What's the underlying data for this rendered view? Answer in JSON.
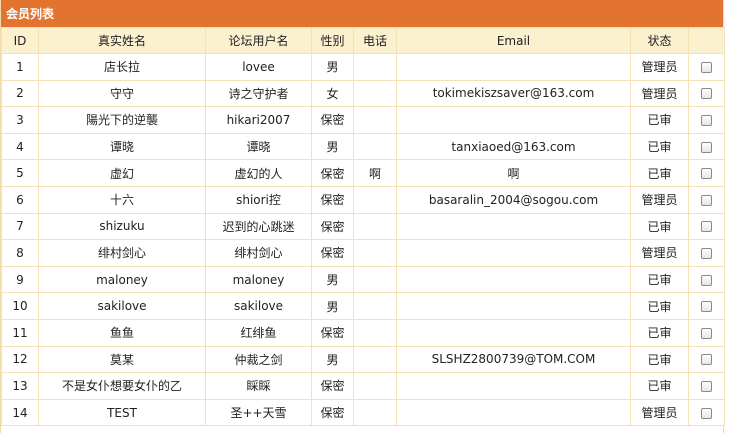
{
  "panel": {
    "title": "会员列表"
  },
  "columns": [
    "ID",
    "真实姓名",
    "论坛用户名",
    "性别",
    "电话",
    "Email",
    "状态",
    ""
  ],
  "rows": [
    {
      "id": "1",
      "real_name": "店长拉",
      "username": "lovee",
      "gender": "男",
      "phone": "",
      "email": "",
      "status": "管理员"
    },
    {
      "id": "2",
      "real_name": "守守",
      "username": "诗之守护者",
      "gender": "女",
      "phone": "",
      "email": "tokimekiszsaver@163.com",
      "status": "管理员"
    },
    {
      "id": "3",
      "real_name": "陽光下的逆襲",
      "username": "hikari2007",
      "gender": "保密",
      "phone": "",
      "email": "",
      "status": "已审"
    },
    {
      "id": "4",
      "real_name": "谭晓",
      "username": "谭晓",
      "gender": "男",
      "phone": "",
      "email": "tanxiaoed@163.com",
      "status": "已审"
    },
    {
      "id": "5",
      "real_name": "虚幻",
      "username": "虚幻的人",
      "gender": "保密",
      "phone": "啊",
      "email": "啊",
      "status": "已审"
    },
    {
      "id": "6",
      "real_name": "十六",
      "username": "shiori控",
      "gender": "保密",
      "phone": "",
      "email": "basaralin_2004@sogou.com",
      "status": "管理员"
    },
    {
      "id": "7",
      "real_name": "shizuku",
      "username": "迟到的心跳迷",
      "gender": "保密",
      "phone": "",
      "email": "",
      "status": "已审"
    },
    {
      "id": "8",
      "real_name": "绯村剑心",
      "username": "绯村剑心",
      "gender": "保密",
      "phone": "",
      "email": "",
      "status": "管理员"
    },
    {
      "id": "9",
      "real_name": "maloney",
      "username": "maloney",
      "gender": "男",
      "phone": "",
      "email": "",
      "status": "已审"
    },
    {
      "id": "10",
      "real_name": "sakilove",
      "username": "sakilove",
      "gender": "男",
      "phone": "",
      "email": "",
      "status": "已审"
    },
    {
      "id": "11",
      "real_name": "鱼鱼",
      "username": "红绯鱼",
      "gender": "保密",
      "phone": "",
      "email": "",
      "status": "已审"
    },
    {
      "id": "12",
      "real_name": "莫某",
      "username": "仲裁之剑",
      "gender": "男",
      "phone": "",
      "email": "SLSHZ2800739@TOM.COM",
      "status": "已审"
    },
    {
      "id": "13",
      "real_name": "不是女仆想要女仆的乙",
      "username": "睬睬",
      "gender": "保密",
      "phone": "",
      "email": "",
      "status": "已审"
    },
    {
      "id": "14",
      "real_name": "TEST",
      "username": "圣++天雪",
      "gender": "保密",
      "phone": "",
      "email": "",
      "status": "管理员"
    }
  ]
}
